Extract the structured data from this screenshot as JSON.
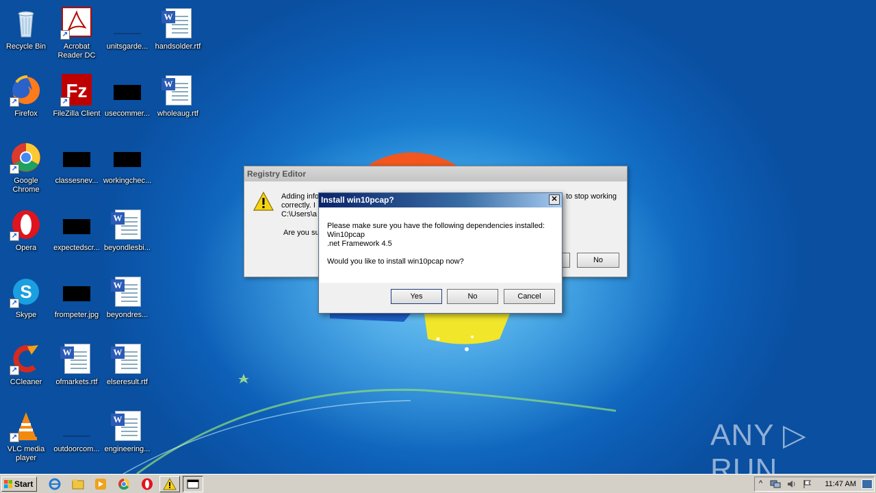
{
  "desktop": {
    "icons": [
      {
        "label": "Recycle Bin"
      },
      {
        "label": "Acrobat Reader DC"
      },
      {
        "label": "unitsgarde..."
      },
      {
        "label": "handsolder.rtf"
      },
      {
        "label": "Firefox"
      },
      {
        "label": "FileZilla Client"
      },
      {
        "label": "usecommer..."
      },
      {
        "label": "wholeaug.rtf"
      },
      {
        "label": "Google Chrome"
      },
      {
        "label": "classesnev..."
      },
      {
        "label": "workingchec..."
      },
      {
        "label": "Opera"
      },
      {
        "label": "expectedscr..."
      },
      {
        "label": "beyondlesbi..."
      },
      {
        "label": "Skype"
      },
      {
        "label": "frompeter.jpg"
      },
      {
        "label": "beyondres..."
      },
      {
        "label": "CCleaner"
      },
      {
        "label": "ofmarkets.rtf"
      },
      {
        "label": "elseresult.rtf"
      },
      {
        "label": "VLC media player"
      },
      {
        "label": "outdoorcom..."
      },
      {
        "label": "engineering..."
      }
    ]
  },
  "registry_dialog": {
    "title": "Registry Editor",
    "line1": "Adding info",
    "line1_right": "to stop working",
    "line2": "correctly. I",
    "line3": "C:\\Users\\a",
    "question": "Are you su",
    "no_label": "No"
  },
  "install_dialog": {
    "title": "Install win10pcap?",
    "close_label": "✕",
    "message": "Please make sure you have the following dependencies installed:",
    "dep1": "Win10pcap",
    "dep2": ".net Framework 4.5",
    "question": "Would you like to install win10pcap now?",
    "yes_label": "Yes",
    "no_label": "No",
    "cancel_label": "Cancel"
  },
  "taskbar": {
    "start_label": "Start",
    "clock": "11:47 AM"
  },
  "watermark": "ANY ▷ RUN"
}
